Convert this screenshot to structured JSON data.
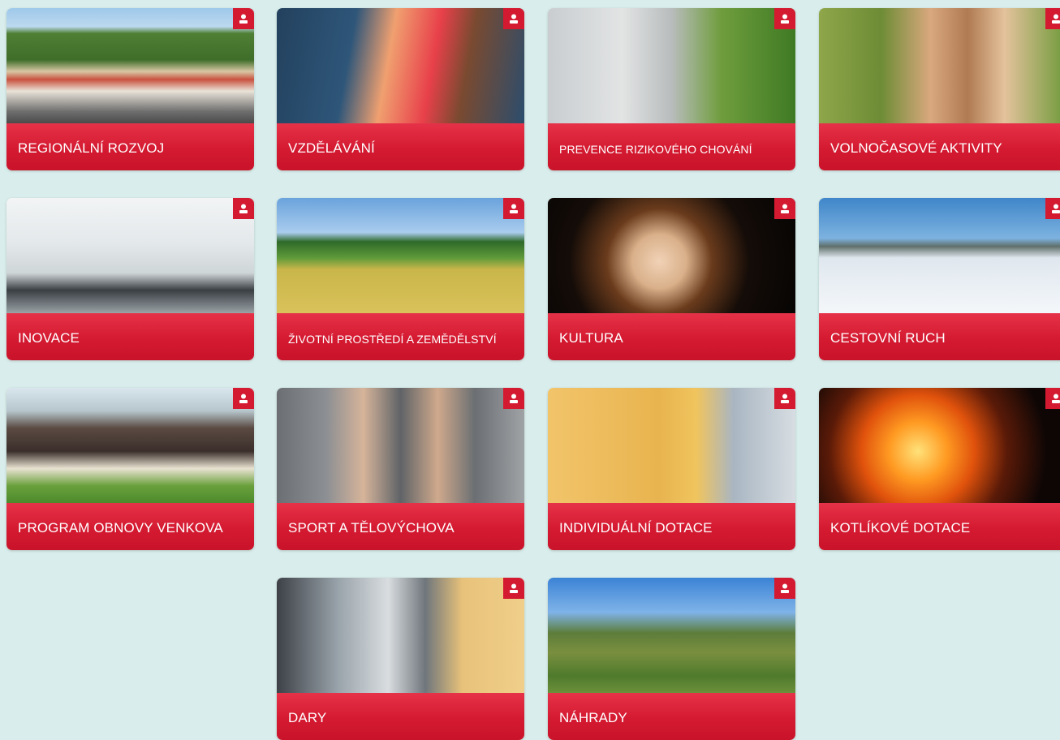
{
  "colors": {
    "background": "#d9eeec",
    "accent": "#d41a31",
    "label_text": "#ffffff"
  },
  "tiles": [
    {
      "label": "REGIONÁLNÍ ROZVOJ",
      "icon": "user-icon",
      "photo": "town-square"
    },
    {
      "label": "VZDĚLÁVÁNÍ",
      "icon": "user-icon",
      "photo": "classroom-children"
    },
    {
      "label": "PREVENCE RIZIKOVÉHO CHOVÁNÍ",
      "icon": "user-icon",
      "photo": "security-camera"
    },
    {
      "label": "VOLNOČASOVÉ AKTIVITY",
      "icon": "user-icon",
      "photo": "hiking-couple"
    },
    {
      "label": "INOVACE",
      "icon": "user-icon",
      "photo": "lab-room"
    },
    {
      "label": "ŽIVOTNÍ PROSTŘEDÍ A ZEMĚDĚLSTVÍ",
      "icon": "user-icon",
      "photo": "wheat-field"
    },
    {
      "label": "KULTURA",
      "icon": "user-icon",
      "photo": "theatre-actors"
    },
    {
      "label": "CESTOVNÍ RUCH",
      "icon": "user-icon",
      "photo": "snowy-landscape"
    },
    {
      "label": "PROGRAM OBNOVY VENKOVA",
      "icon": "user-icon",
      "photo": "village-house"
    },
    {
      "label": "SPORT A TĚLOVÝCHOVA",
      "icon": "user-icon",
      "photo": "athletes-medals"
    },
    {
      "label": "INDIVIDUÁLNÍ DOTACE",
      "icon": "user-icon",
      "photo": "historic-building"
    },
    {
      "label": "KOTLÍKOVÉ DOTACE",
      "icon": "user-icon",
      "photo": "fireplace"
    },
    {
      "label": "DARY",
      "icon": "user-icon",
      "photo": "glass-building"
    },
    {
      "label": "NÁHRADY",
      "icon": "user-icon",
      "photo": "mountains"
    }
  ]
}
